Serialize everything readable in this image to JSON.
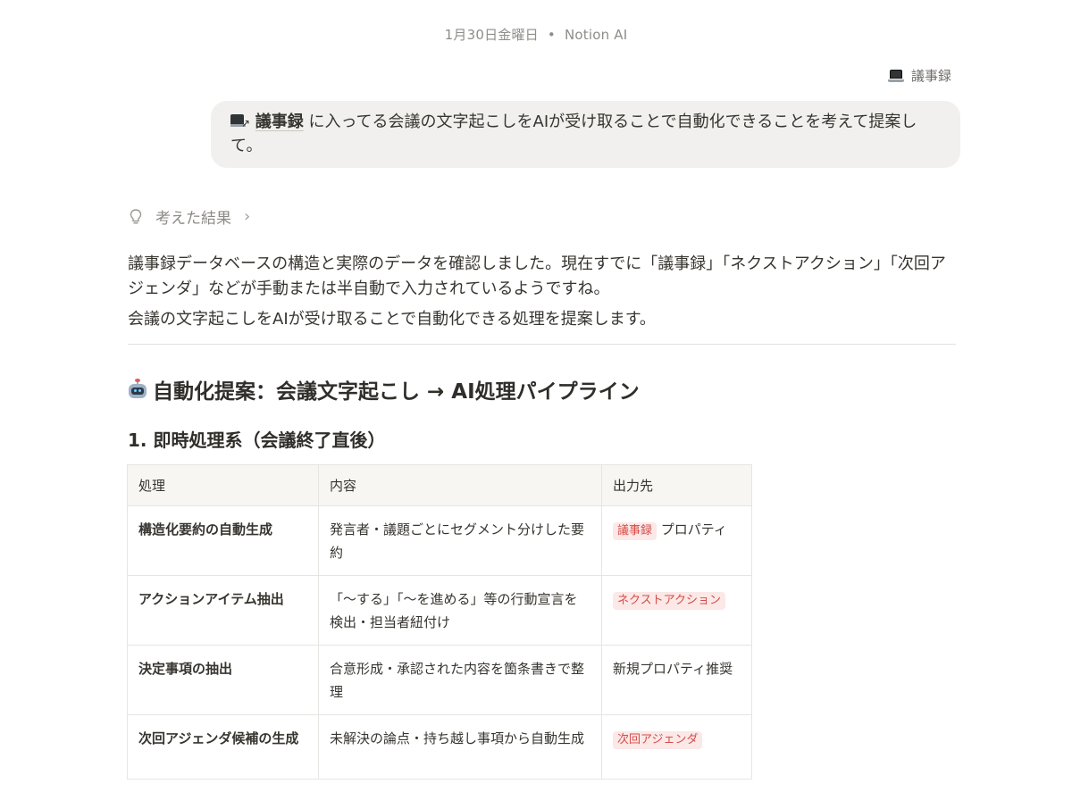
{
  "header": {
    "date": "1月30日金曜日",
    "separator": "•",
    "assistant": "Notion AI"
  },
  "page_reference": {
    "icon": "laptop-icon",
    "label": "議事録"
  },
  "user_message": {
    "mention_icon": "laptop-arrow-icon",
    "mention": "議事録",
    "text": " に入ってる会議の文字起こしをAIが受け取ることで自動化できることを考えて提案して。"
  },
  "thinking": {
    "icon": "bulb-icon",
    "label": "考えた結果",
    "chevron": "›"
  },
  "response": {
    "paragraph1": "議事録データベースの構造と実際のデータを確認しました。現在すでに「議事録」「ネクストアクション」「次回アジェンダ」などが手動または半自動で入力されているようですね。",
    "paragraph2": "会議の文字起こしをAIが受け取ることで自動化できる処理を提案します。",
    "heading2_icon": "robot-icon",
    "heading2": "自動化提案：会議文字起こし → AI処理パイプライン",
    "heading3": "1. 即時処理系（会議終了直後）"
  },
  "table": {
    "headers": [
      "処理",
      "内容",
      "出力先"
    ],
    "rows": [
      {
        "process": "構造化要約の自動生成",
        "content": "発言者・議題ごとにセグメント分けした要約",
        "output_tag": "議事録",
        "output_text": " プロパティ"
      },
      {
        "process": "アクションアイテム抽出",
        "content": "「〜する」「〜を進める」等の行動宣言を検出・担当者紐付け",
        "output_tag": "ネクストアクション",
        "output_text": ""
      },
      {
        "process": "決定事項の抽出",
        "content": "合意形成・承認された内容を箇条書きで整理",
        "output_tag": "",
        "output_text": "新規プロパティ推奨"
      },
      {
        "process": "次回アジェンダ候補の生成",
        "content": "未解決の論点・持ち越し事項から自動生成",
        "output_tag": "次回アジェンダ",
        "output_text": ""
      }
    ]
  },
  "colors": {
    "tag_background": "#fbe8e7",
    "tag_text": "#d44c47",
    "bubble_background": "#f1f0ee"
  }
}
